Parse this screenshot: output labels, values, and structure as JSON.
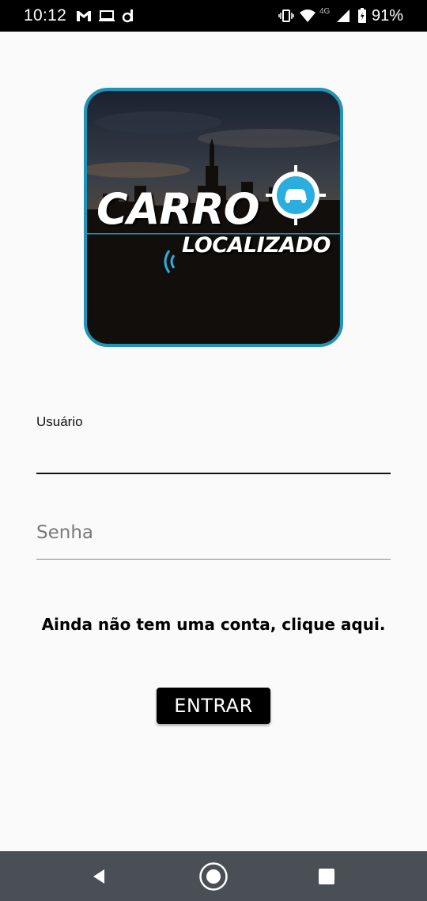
{
  "status_bar": {
    "time": "10:12",
    "network": "4G",
    "battery": "91%",
    "icons": [
      "gmail-icon",
      "laptop-icon",
      "d-app-icon",
      "vibrate-icon",
      "wifi-icon",
      "signal-icon",
      "battery-icon"
    ]
  },
  "logo": {
    "line1": "CARRO",
    "line2": "LOCALIZADO",
    "accent_color": "#1f93b8"
  },
  "form": {
    "username_label": "Usuário",
    "username_value": "",
    "password_placeholder": "Senha"
  },
  "signup_link": "Ainda não tem uma conta, clique aqui.",
  "login_button": "ENTRAR",
  "nav_bar": {
    "buttons": [
      "back-icon",
      "home-icon",
      "recents-icon"
    ]
  }
}
